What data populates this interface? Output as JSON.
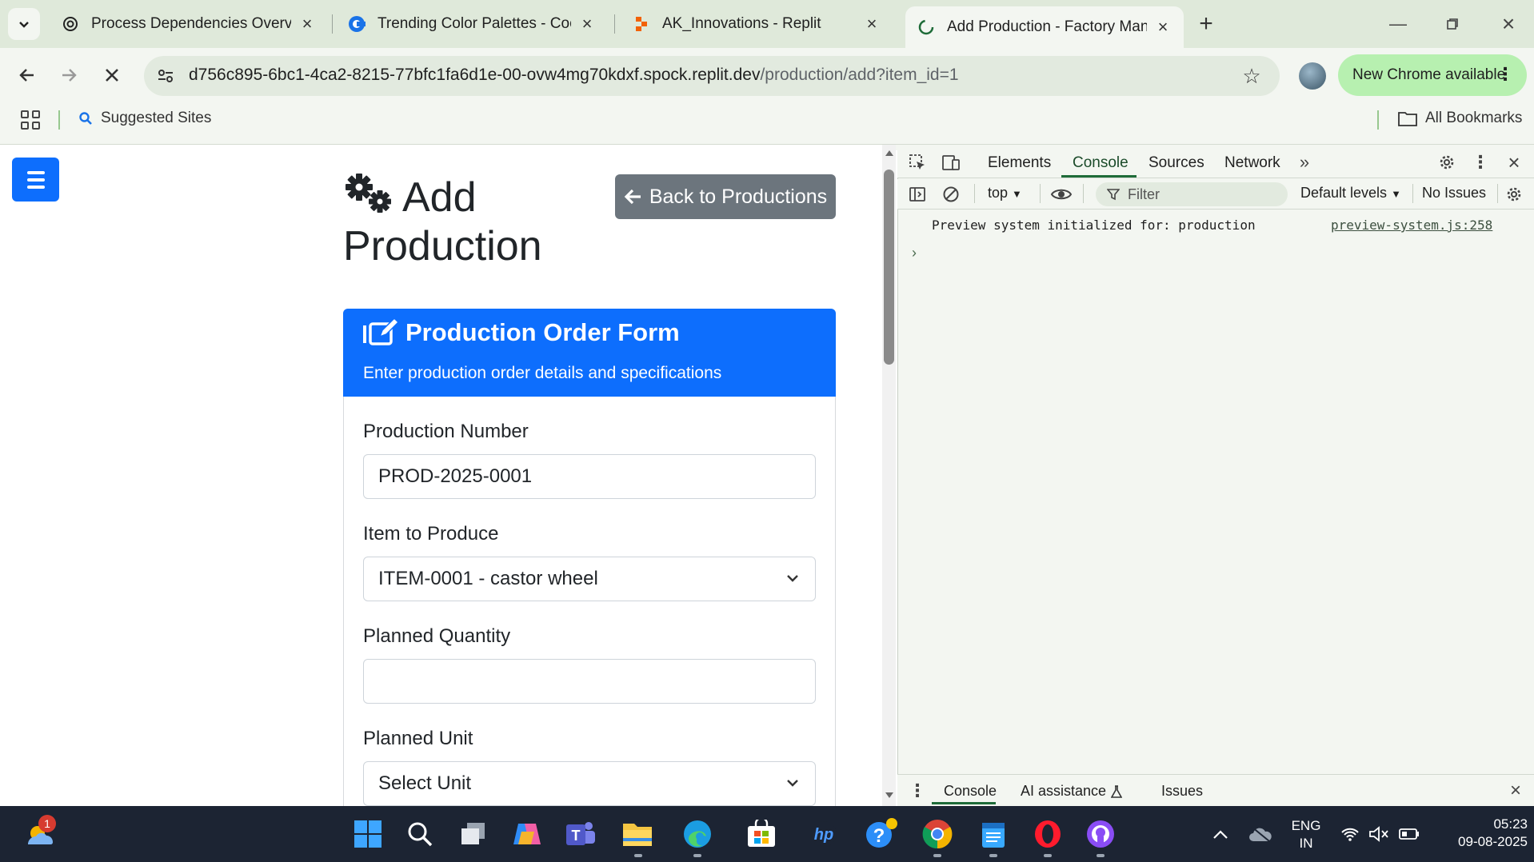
{
  "browser": {
    "tabs": [
      {
        "title": "Process Dependencies Overview",
        "icon": "openai-icon",
        "active": false
      },
      {
        "title": "Trending Color Palettes - Coolors",
        "icon": "coolors-icon",
        "active": false
      },
      {
        "title": "AK_Innovations - Replit",
        "icon": "replit-icon",
        "active": false
      },
      {
        "title": "Add Production - Factory Management",
        "icon": "loading-globe-icon",
        "active": true
      }
    ],
    "url_host": "d756c895-6bc1-4ca2-8215-77bfc1fa6d1e-00-ovw4mg70kdxf.spock.replit.dev",
    "url_path": "/production/add?item_id=1",
    "new_chrome_label": "New Chrome available",
    "bookmarks": {
      "suggested": "Suggested Sites",
      "all": "All Bookmarks"
    }
  },
  "page": {
    "title": "Add Production",
    "back_button": "Back to Productions",
    "card": {
      "title": "Production Order Form",
      "subtitle": "Enter production order details and specifications"
    },
    "fields": {
      "production_number": {
        "label": "Production Number",
        "value": "PROD-2025-0001"
      },
      "item": {
        "label": "Item to Produce",
        "value": "ITEM-0001 - castor wheel"
      },
      "planned_quantity": {
        "label": "Planned Quantity",
        "value": ""
      },
      "planned_unit": {
        "label": "Planned Unit",
        "value": "Select Unit"
      }
    }
  },
  "devtools": {
    "tabs": [
      "Elements",
      "Console",
      "Sources",
      "Network"
    ],
    "active_tab": "Console",
    "context": "top",
    "filter_placeholder": "Filter",
    "levels": "Default levels",
    "issues": "No Issues",
    "console_message": "Preview system initialized for: production",
    "console_source": "preview-system.js:258",
    "drawer_tabs": [
      "Console",
      "AI assistance",
      "Issues"
    ]
  },
  "taskbar": {
    "weather_badge": "1",
    "language_line1": "ENG",
    "language_line2": "IN",
    "time": "05:23",
    "date": "09-08-2025"
  },
  "colors": {
    "primary": "#0d6efd",
    "secondary_button": "#6c757d",
    "chrome_frame": "#dfe9da",
    "new_chrome_badge": "#b7f0b0"
  }
}
